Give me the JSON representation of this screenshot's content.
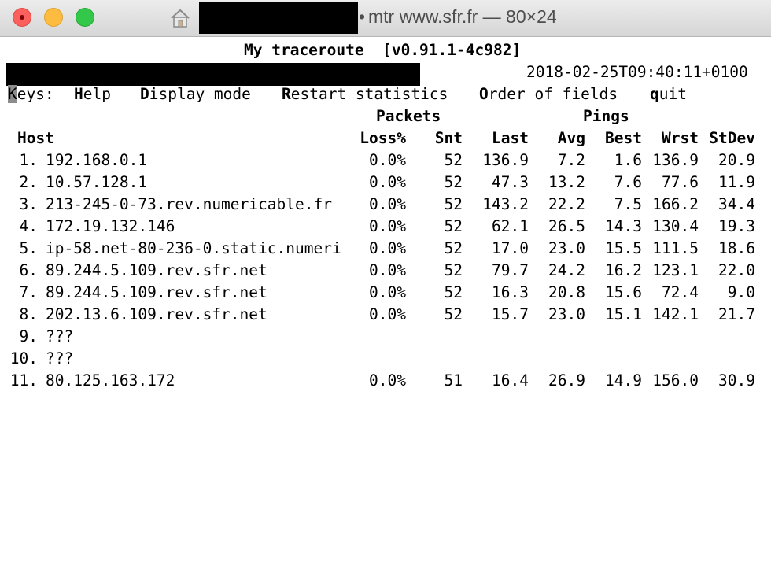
{
  "window": {
    "title": "mtr www.sfr.fr — 80×24",
    "title_prefix_glyph": "•"
  },
  "header": {
    "title": "My traceroute  [v0.91.1-4c982]",
    "timestamp": "2018-02-25T09:40:11+0100"
  },
  "keys": {
    "label_lead": "K",
    "label_rest": "eys:",
    "help_key": "H",
    "help_rest": "elp",
    "display_key": "D",
    "display_rest": "isplay mode",
    "restart_key": "R",
    "restart_rest": "estart statistics",
    "order_key": "O",
    "order_rest": "rder of fields",
    "quit_key": "q",
    "quit_rest": "uit"
  },
  "table": {
    "group_packets": "Packets",
    "group_pings": "Pings",
    "headers": {
      "host": "Host",
      "loss": "Loss%",
      "snt": "Snt",
      "last": "Last",
      "avg": "Avg",
      "best": "Best",
      "wrst": "Wrst",
      "stdev": "StDev"
    },
    "rows": [
      {
        "num": "1.",
        "host": "192.168.0.1",
        "loss": "0.0%",
        "snt": "52",
        "last": "136.9",
        "avg": "7.2",
        "best": "1.6",
        "wrst": "136.9",
        "stdev": "20.9"
      },
      {
        "num": "2.",
        "host": "10.57.128.1",
        "loss": "0.0%",
        "snt": "52",
        "last": "47.3",
        "avg": "13.2",
        "best": "7.6",
        "wrst": "77.6",
        "stdev": "11.9"
      },
      {
        "num": "3.",
        "host": "213-245-0-73.rev.numericable.fr",
        "loss": "0.0%",
        "snt": "52",
        "last": "143.2",
        "avg": "22.2",
        "best": "7.5",
        "wrst": "166.2",
        "stdev": "34.4"
      },
      {
        "num": "4.",
        "host": "172.19.132.146",
        "loss": "0.0%",
        "snt": "52",
        "last": "62.1",
        "avg": "26.5",
        "best": "14.3",
        "wrst": "130.4",
        "stdev": "19.3"
      },
      {
        "num": "5.",
        "host": "ip-58.net-80-236-0.static.numeri",
        "loss": "0.0%",
        "snt": "52",
        "last": "17.0",
        "avg": "23.0",
        "best": "15.5",
        "wrst": "111.5",
        "stdev": "18.6"
      },
      {
        "num": "6.",
        "host": "89.244.5.109.rev.sfr.net",
        "loss": "0.0%",
        "snt": "52",
        "last": "79.7",
        "avg": "24.2",
        "best": "16.2",
        "wrst": "123.1",
        "stdev": "22.0"
      },
      {
        "num": "7.",
        "host": "89.244.5.109.rev.sfr.net",
        "loss": "0.0%",
        "snt": "52",
        "last": "16.3",
        "avg": "20.8",
        "best": "15.6",
        "wrst": "72.4",
        "stdev": "9.0"
      },
      {
        "num": "8.",
        "host": "202.13.6.109.rev.sfr.net",
        "loss": "0.0%",
        "snt": "52",
        "last": "15.7",
        "avg": "23.0",
        "best": "15.1",
        "wrst": "142.1",
        "stdev": "21.7"
      },
      {
        "num": "9.",
        "host": "???",
        "loss": "",
        "snt": "",
        "last": "",
        "avg": "",
        "best": "",
        "wrst": "",
        "stdev": ""
      },
      {
        "num": "10.",
        "host": "???",
        "loss": "",
        "snt": "",
        "last": "",
        "avg": "",
        "best": "",
        "wrst": "",
        "stdev": ""
      },
      {
        "num": "11.",
        "host": "80.125.163.172",
        "loss": "0.0%",
        "snt": "51",
        "last": "16.4",
        "avg": "26.9",
        "best": "14.9",
        "wrst": "156.0",
        "stdev": "30.9"
      }
    ]
  }
}
